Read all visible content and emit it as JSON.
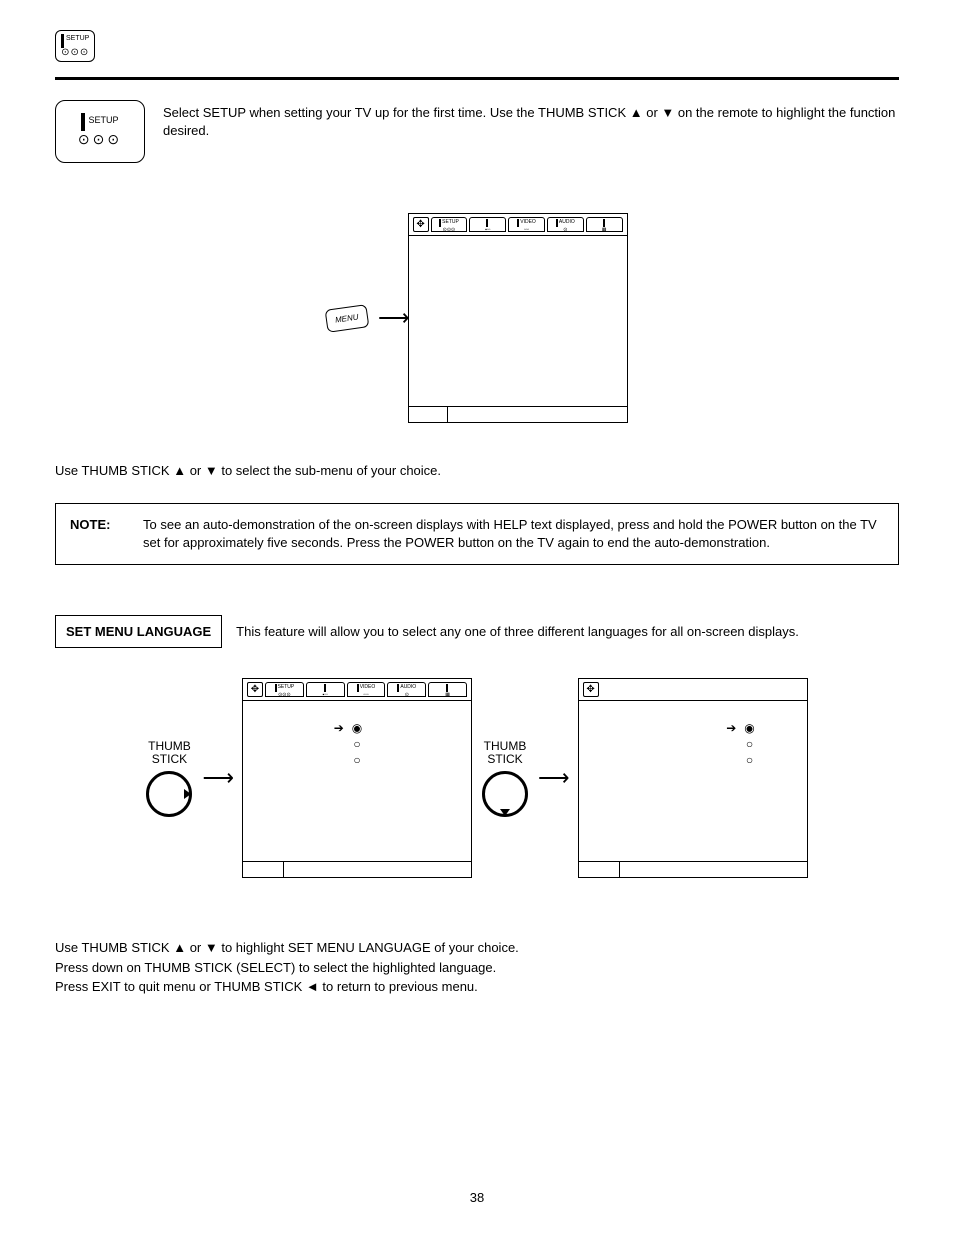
{
  "icons": {
    "setup_label": "SETUP",
    "video_label": "VIDEO",
    "audio_label": "AUDIO"
  },
  "intro": {
    "text": "Select SETUP when setting your TV up for the first time.  Use the THUMB STICK ▲ or ▼ on the remote to highlight the function desired."
  },
  "menu_btn": "MENU",
  "instruction1": "Use THUMB STICK ▲ or ▼ to select the sub-menu of your choice.",
  "note": {
    "label": "NOTE:",
    "text": "To see an auto-demonstration of the on-screen displays with HELP text displayed, press and hold the POWER button on the TV set for approximately five seconds. Press the POWER button on the TV again to end the auto-demonstration."
  },
  "section": {
    "title": "SET MENU LANGUAGE",
    "desc": "This feature will allow you to select any one of three different languages for all on-screen displays."
  },
  "thumb_label": "THUMB\nSTICK",
  "final": {
    "l1": "Use THUMB STICK ▲ or ▼ to highlight SET MENU LANGUAGE of your choice.",
    "l2": "Press down on THUMB STICK (SELECT) to select the highlighted language.",
    "l3": "Press EXIT to quit menu or THUMB STICK ◄ to return to previous menu."
  },
  "page_number": "38"
}
